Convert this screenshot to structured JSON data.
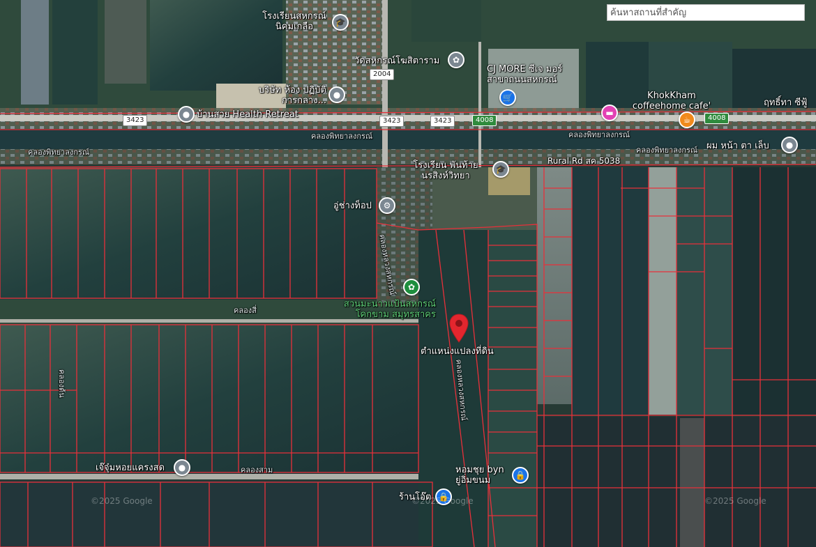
{
  "search": {
    "placeholder": "ค้นหาสถานที่สำคัญ"
  },
  "pois": [
    {
      "label": "โรงเรียนสหกรณ์ นิคมเกลือ",
      "icon": "school-icon"
    },
    {
      "label": "วัดสหกรณ์โฆสิตาราม",
      "icon": "temple-icon"
    },
    {
      "label": "บริษัท ห้อง ปฏิบัติการกลาง...",
      "icon": "place-icon"
    },
    {
      "label": "บ้านสวย Health Retreat",
      "icon": "place-icon"
    },
    {
      "label": "CJ MORE ซีเจ มอร์ สาขาถนนสหกรณ์",
      "icon": "shopping-cart-icon"
    },
    {
      "label": "KhokKham coffeehome cafe'",
      "icon": "cafe-icon"
    },
    {
      "label": "ฤทธิ์ทา ซีฟู้",
      "icon": "place-icon"
    },
    {
      "label": "ผม หน้า ตา เล็บ",
      "icon": "place-icon"
    },
    {
      "label": "โรงเรียน พันท้ายนรสิงห์วิทยา",
      "icon": "school-icon"
    },
    {
      "label": "อู่ช่างท็อป",
      "icon": "repair-icon"
    },
    {
      "label": "สวนมะนาวแป้นสหกรณ์ โคกขาม สมุทรสาคร",
      "icon": "garden-icon"
    },
    {
      "label": "เจ๊จุ๋มหอยแครงสด",
      "icon": "place-icon"
    },
    {
      "label": "หอมชุย byn ยู่อิ่มขนม",
      "icon": "shopping-bag-icon"
    },
    {
      "label": "ร้านโอ๊ต",
      "icon": "shopping-bag-icon"
    }
  ],
  "marker": {
    "label": "ตำแหน่งแปลงที่ดิน"
  },
  "roads": {
    "shields": [
      "3423",
      "3423",
      "3423",
      "4008",
      "4008",
      "2004"
    ],
    "rural_road": "Rural Rd สค 5038",
    "labels": [
      "คลองพิทยาลงกรณ์",
      "คลองพิทยาลงกรณ์",
      "คลองพิทยาลงกรณ์",
      "คลองพิทยาลงกรณ์",
      "คลองสี่",
      "คลองสาม",
      "คลองหลวงสหกรณ์",
      "คลองหลวงสหกรณ์",
      "คลองต้น"
    ]
  },
  "watermarks": [
    "©2025 Google",
    "©2025 Google",
    "©2025 Google"
  ],
  "colors": {
    "parcel_line": "#e8303a",
    "marker": "#e3262e",
    "water": "#1f3b3f",
    "road": "#c9c9c2"
  }
}
